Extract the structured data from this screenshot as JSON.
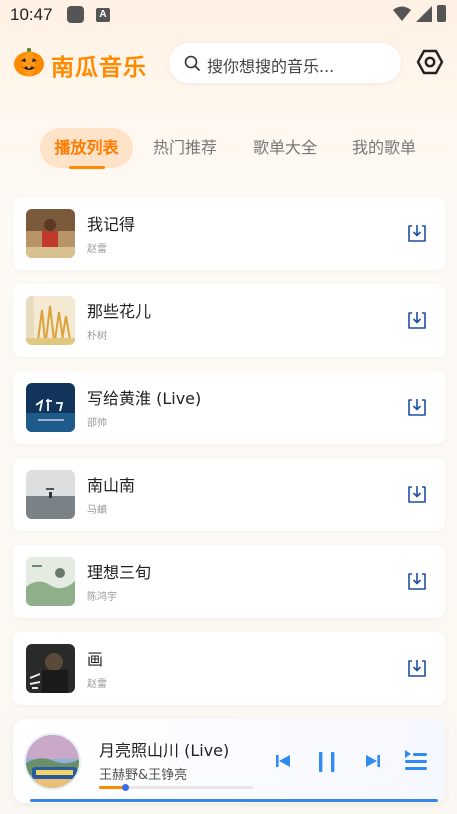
{
  "status_bar": {
    "time": "10:47",
    "a_icon": "A"
  },
  "header": {
    "app_title": "南瓜音乐",
    "search_placeholder": "搜你想搜的音乐...",
    "logo_icon": "pumpkin-icon",
    "settings_icon": "hexagon-settings-icon"
  },
  "tabs": [
    {
      "label": "播放列表",
      "active": true
    },
    {
      "label": "热门推荐",
      "active": false
    },
    {
      "label": "歌单大全",
      "active": false
    },
    {
      "label": "我的歌单",
      "active": false
    }
  ],
  "songs": [
    {
      "title": "我记得",
      "artist": "赵雷",
      "cover_color": "#8a6a4a"
    },
    {
      "title": "那些花儿",
      "artist": "朴树",
      "cover_color": "#e9d6a8"
    },
    {
      "title": "写给黄淮 (Live)",
      "artist": "邵帅",
      "cover_color": "#1e5a8a"
    },
    {
      "title": "南山南",
      "artist": "马頔",
      "cover_color": "#c9ccce"
    },
    {
      "title": "理想三旬",
      "artist": "陈鸿宇",
      "cover_color": "#c7d4c0"
    },
    {
      "title": "画",
      "artist": "赵雷",
      "cover_color": "#3a3a3a"
    }
  ],
  "player": {
    "title": "月亮照山川 (Live)",
    "artist": "王赫野&王铮亮",
    "progress": 0.17
  },
  "colors": {
    "accent": "#ff8a00",
    "blue": "#2f8bf0"
  }
}
